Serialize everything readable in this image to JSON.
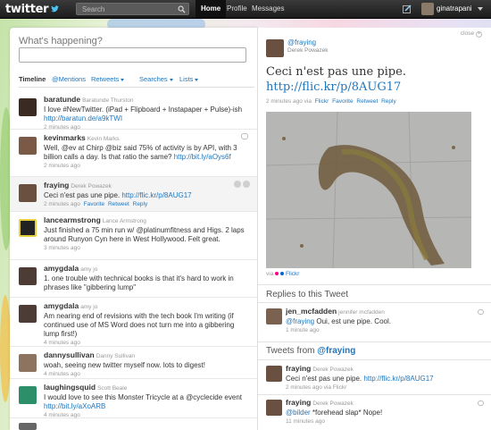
{
  "colors": {
    "link": "#2276bb",
    "topbar": "#1c1c1c",
    "accent_flickr_blue": "#0063dc",
    "accent_flickr_pink": "#ff0084"
  },
  "topbar": {
    "logo": "twitter",
    "search_placeholder": "Search",
    "nav": [
      "Home",
      "Profile",
      "Messages"
    ],
    "username": "ginatrapani"
  },
  "compose": {
    "prompt": "What's happening?"
  },
  "tabs": [
    {
      "label": "Timeline",
      "dropdown": false
    },
    {
      "label": "@Mentions",
      "dropdown": false
    },
    {
      "label": "Retweets",
      "dropdown": true
    },
    {
      "label": "Searches",
      "dropdown": true
    },
    {
      "label": "Lists",
      "dropdown": true
    }
  ],
  "timeline": [
    {
      "user": "baratunde",
      "real": "Baratunde Thurston",
      "text": "I love #NewTwitter. (iPad + Flipboard + Instapaper + Pulse)-ish ",
      "link": "http://baratun.de/a9kTWI",
      "time": "2 minutes ago"
    },
    {
      "user": "kevinmarks",
      "real": "Kevin Marks",
      "text": "Well, @ev at Chirp @biz said 75% of activity is by API, with 3 billion calls a day. Is that ratio the same? ",
      "link": "http://bit.ly/aOys6f",
      "time": "2 minutes ago"
    },
    {
      "user": "fraying",
      "real": "Derek Powazek",
      "text": "Ceci n'est pas une pipe. ",
      "link": "http://flic.kr/p/8AUG17",
      "time": "2 minutes ago",
      "actions": [
        "Favorite",
        "Retweet",
        "Reply"
      ]
    },
    {
      "user": "lancearmstrong",
      "real": "Lance Armstrong",
      "text": "Just finished a 75 min run w/ @platinumfitness and Higs. 2 laps around Runyon Cyn here in West Hollywood. Felt great.",
      "link": "",
      "time": "3 minutes ago"
    },
    {
      "user": "amygdala",
      "real": "amy jo",
      "text": "1. one trouble with technical books is that it's hard to work in phrases like \"gibbering lump\"",
      "link": "",
      "time": "3 minutes ago"
    },
    {
      "user": "amygdala",
      "real": "amy jo",
      "text": "Am nearing end of revisions with the tech book I'm writing (if continued use of MS Word does not turn me into a gibbering lump first!)",
      "link": "",
      "time": "4 minutes ago"
    },
    {
      "user": "dannysullivan",
      "real": "Danny Sullivan",
      "text": "woah, seeing new twitter myself now. lots to digest!",
      "link": "",
      "time": "4 minutes ago"
    },
    {
      "user": "laughingsquid",
      "real": "Scott Beale",
      "text": "I would love to see this Monster Tricycle at a @cyclecide event ",
      "link": "http://bit.ly/aXoARB",
      "time": "4 minutes ago"
    }
  ],
  "details": {
    "close_label": "close",
    "user": "@fraying",
    "real": "Derek Powazek",
    "text": "Ceci n'est pas une pipe. ",
    "link": "http://flic.kr/p/8AUG17",
    "meta_time": "2 minutes ago via",
    "meta_source": "Flickr",
    "actions": [
      "Favorite",
      "Retweet",
      "Reply"
    ],
    "via_label": "via",
    "via_source": "Flickr",
    "replies_title": "Replies to this Tweet",
    "replies": [
      {
        "user": "jen_mcfadden",
        "real": "jennifer mcfadden",
        "mention": "@fraying",
        "text": " Oui, est une pipe. Cool.",
        "time": "1 minute ago"
      }
    ],
    "from_title_prefix": "Tweets from ",
    "from_title_user": "@fraying",
    "from_tweets": [
      {
        "user": "fraying",
        "real": "Derek Powazek",
        "text": "Ceci n'est pas une pipe. ",
        "link": "http://flic.kr/p/8AUG17",
        "time": "2 minutes ago via Flickr"
      },
      {
        "user": "fraying",
        "real": "Derek Powazek",
        "mention": "@bilder",
        "text": " *forehead slap* Nope!",
        "time": "11 minutes ago"
      }
    ]
  }
}
